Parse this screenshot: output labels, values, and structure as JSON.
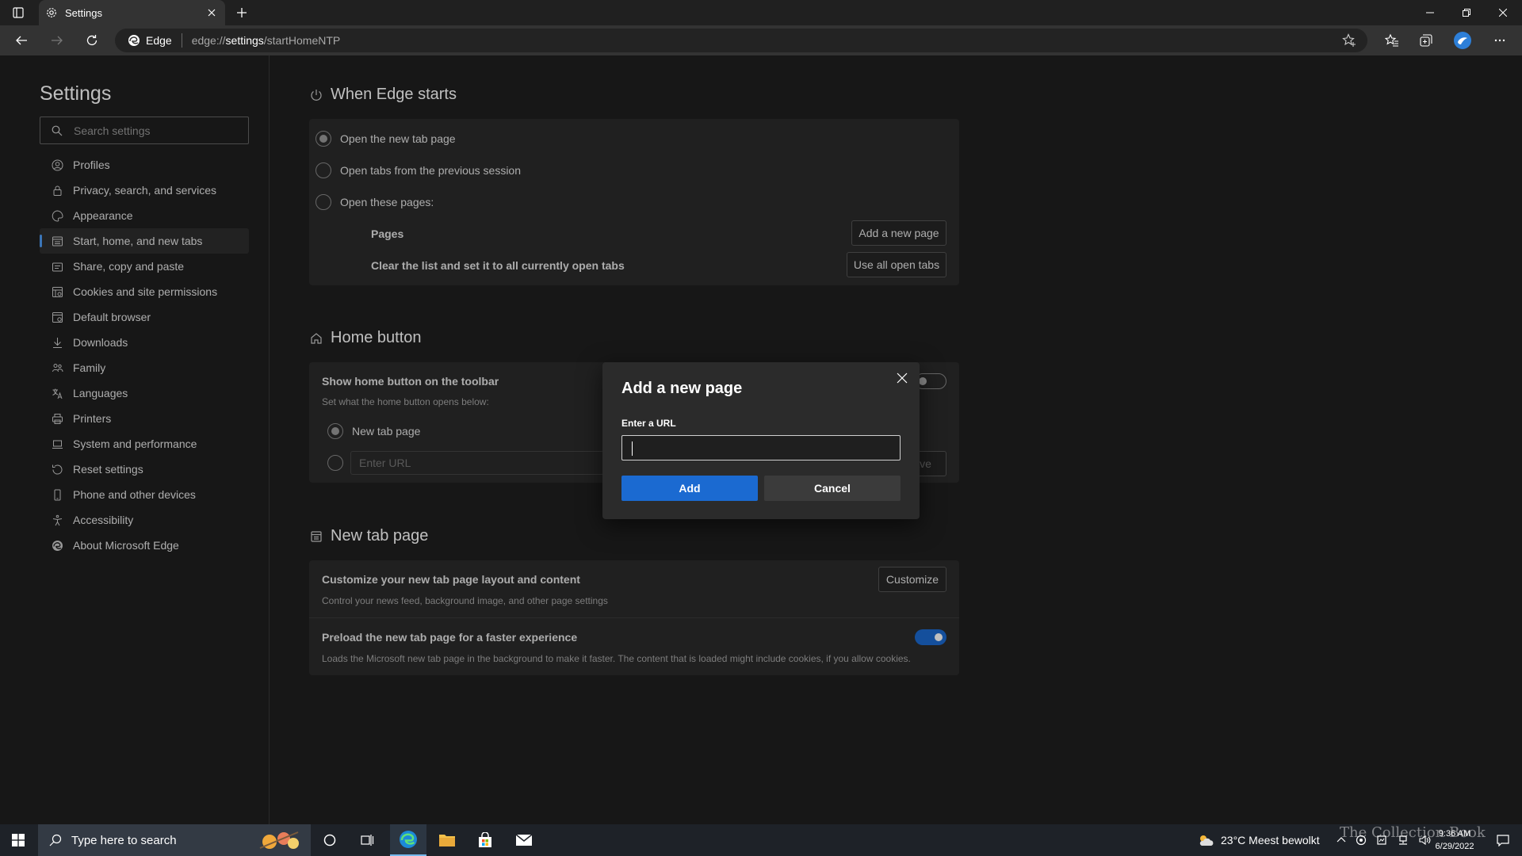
{
  "browser": {
    "tab_title": "Settings",
    "address_chip": "Edge",
    "url_prefix": "edge://",
    "url_highlight": "settings",
    "url_suffix": "/startHomeNTP"
  },
  "sidebar": {
    "title": "Settings",
    "search_placeholder": "Search settings",
    "items": [
      {
        "label": "Profiles",
        "icon": "profile-icon"
      },
      {
        "label": "Privacy, search, and services",
        "icon": "lock-icon"
      },
      {
        "label": "Appearance",
        "icon": "palette-icon"
      },
      {
        "label": "Start, home, and new tabs",
        "icon": "tab-icon",
        "active": true
      },
      {
        "label": "Share, copy and paste",
        "icon": "share-icon"
      },
      {
        "label": "Cookies and site permissions",
        "icon": "cookie-icon"
      },
      {
        "label": "Default browser",
        "icon": "browser-icon"
      },
      {
        "label": "Downloads",
        "icon": "download-icon"
      },
      {
        "label": "Family",
        "icon": "family-icon"
      },
      {
        "label": "Languages",
        "icon": "language-icon"
      },
      {
        "label": "Printers",
        "icon": "printer-icon"
      },
      {
        "label": "System and performance",
        "icon": "laptop-icon"
      },
      {
        "label": "Reset settings",
        "icon": "reset-icon"
      },
      {
        "label": "Phone and other devices",
        "icon": "phone-icon"
      },
      {
        "label": "Accessibility",
        "icon": "accessibility-icon"
      },
      {
        "label": "About Microsoft Edge",
        "icon": "edge-icon"
      }
    ]
  },
  "startup": {
    "title": "When Edge starts",
    "option_newtab": "Open the new tab page",
    "option_previous": "Open tabs from the previous session",
    "option_pages": "Open these pages:",
    "pages_label": "Pages",
    "add_page_button": "Add a new page",
    "clear_label": "Clear the list and set it to all currently open tabs",
    "use_open_tabs_button": "Use all open tabs"
  },
  "home": {
    "title": "Home button",
    "show_label": "Show home button on the toolbar",
    "show_sub": "Set what the home button opens below:",
    "option_newtab": "New tab page",
    "url_placeholder": "Enter URL",
    "save_button": "Save"
  },
  "newtab": {
    "title": "New tab page",
    "customize_label": "Customize your new tab page layout and content",
    "customize_sub": "Control your news feed, background image, and other page settings",
    "customize_button": "Customize",
    "preload_label": "Preload the new tab page for a faster experience",
    "preload_sub": "Loads the Microsoft new tab page in the background to make it faster. The content that is loaded might include cookies, if you allow cookies.",
    "preload_on": true
  },
  "dialog": {
    "title": "Add a new page",
    "url_label": "Enter a URL",
    "url_value": "",
    "add_button": "Add",
    "cancel_button": "Cancel"
  },
  "taskbar": {
    "search_placeholder": "Type here to search",
    "weather": "23°C  Meest bewolkt",
    "time": "9:36 AM",
    "date": "6/29/2022"
  },
  "watermark": "The Collection Book",
  "colors": {
    "accent": "#1b6ad1",
    "background": "#1f1f1f",
    "card": "#2b2b2b"
  }
}
